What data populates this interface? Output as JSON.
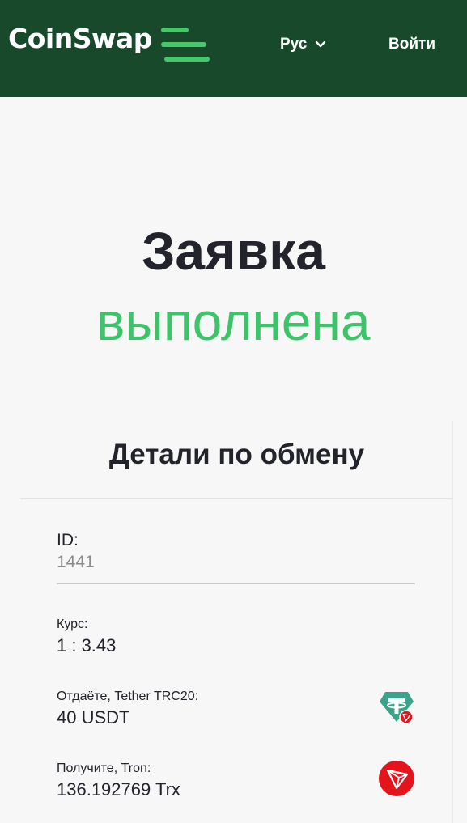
{
  "header": {
    "logo_text": "CoinSwap",
    "language_label": "Рус",
    "login_label": "Войти",
    "bg_color": "#17492a",
    "accent_color": "#46c86a"
  },
  "hero": {
    "title_line1": "Заявка",
    "title_line2": "выполнена",
    "success_color": "#3dc468"
  },
  "details": {
    "title": "Детали по обмену",
    "id_label": "ID:",
    "id_value": "1441",
    "rate_label": "Курс:",
    "rate_value": "1 : 3.43",
    "give_label": "Отдаёте, Tether TRC20:",
    "give_value": "40 USDT",
    "give_icon": "tether-trc20-icon",
    "receive_label": "Получите, Tron:",
    "receive_value": "136.192769 Trx",
    "receive_icon": "tron-icon",
    "tether_color": "#3aa38a",
    "tron_color": "#e3141c"
  }
}
